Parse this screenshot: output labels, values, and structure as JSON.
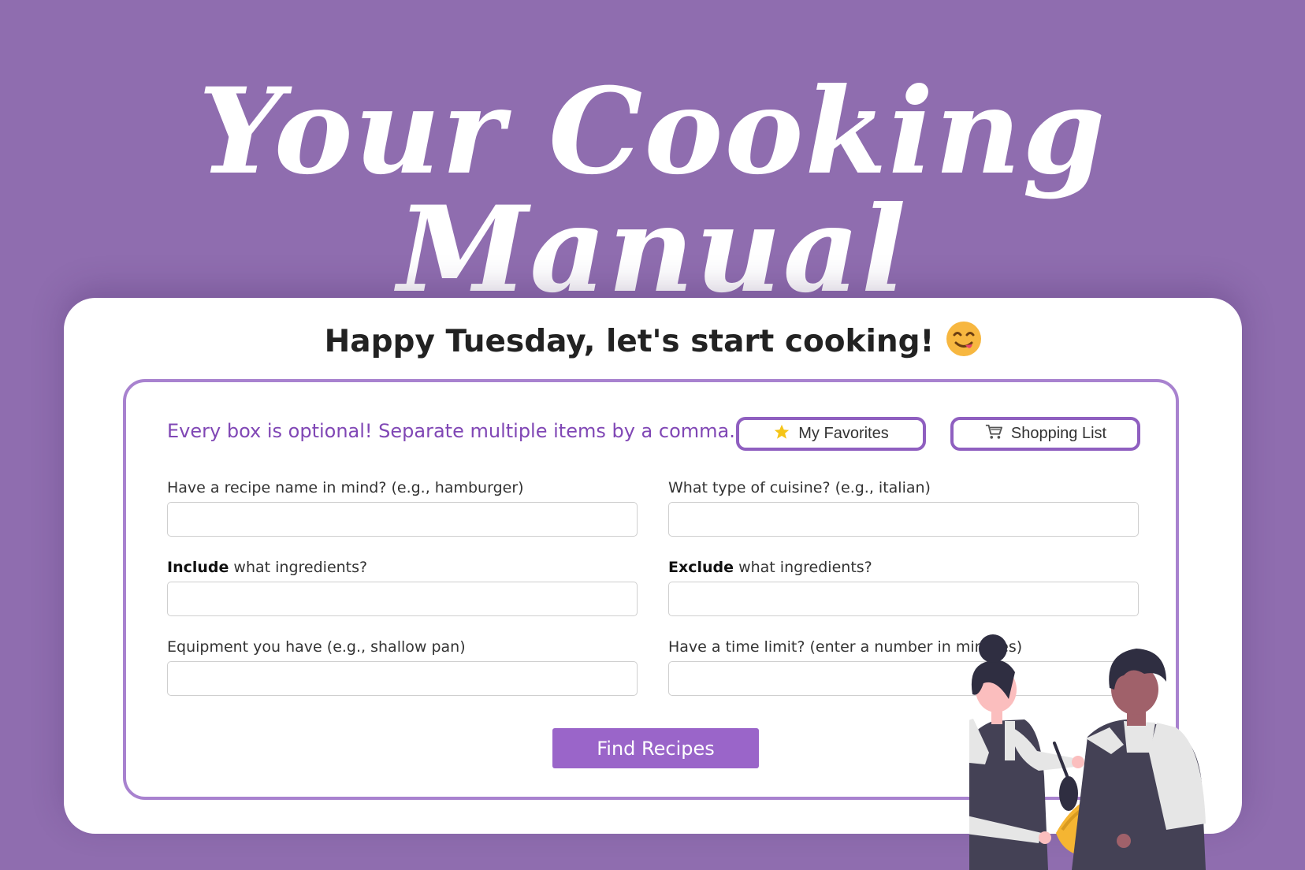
{
  "header": {
    "title": "Your Cooking Manual"
  },
  "card": {
    "greeting": "Happy Tuesday, let's start cooking!",
    "greeting_emoji": "face-savoring-food-emoji"
  },
  "form": {
    "hint": "Every box is optional! Separate multiple items by a comma.",
    "favorites_label": "My Favorites",
    "favorites_icon": "star-icon",
    "shopping_label": "Shopping List",
    "shopping_icon": "cart-icon",
    "fields": [
      {
        "label": "Have a recipe name in mind? (e.g., hamburger)",
        "value": ""
      },
      {
        "label": "What type of cuisine? (e.g., italian)",
        "value": ""
      },
      {
        "label_bold": "Include",
        "label_rest": " what ingredients?",
        "value": ""
      },
      {
        "label_bold": "Exclude",
        "label_rest": " what ingredients?",
        "value": ""
      },
      {
        "label": "Equipment you have (e.g., shallow pan)",
        "value": ""
      },
      {
        "label": "Have a time limit? (enter a number in minutes)",
        "value": ""
      }
    ],
    "submit_label": "Find Recipes"
  },
  "colors": {
    "background": "#8f6daf",
    "accent": "#9a65c9",
    "hint_text": "#8047b5",
    "panel_border": "#a882cf"
  }
}
